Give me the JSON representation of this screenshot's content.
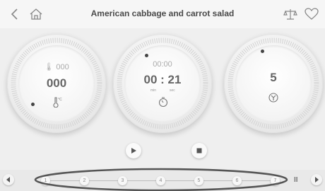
{
  "header": {
    "title": "American cabbage and carrot salad",
    "icons": [
      "back-chevron-icon",
      "home-icon",
      "scale-icon",
      "heart-icon"
    ]
  },
  "temperature_dial": {
    "top_value": "000",
    "main_value": "000",
    "icon": "thermometer-celsius-icon"
  },
  "timer_dial": {
    "top_value": "00:00",
    "main_value": "00 : 21",
    "unit_min": "min",
    "unit_sec": "sec",
    "icon": "timer-icon"
  },
  "speed_dial": {
    "main_value": "5",
    "icon": "fan-speed-icon"
  },
  "controls": {
    "play": "play-icon",
    "stop": "stop-icon"
  },
  "steps": {
    "labels": [
      "1",
      "2",
      "3",
      "4",
      "5",
      "6",
      "7"
    ],
    "pause": "II"
  },
  "colors": {
    "background": "#efefef",
    "accent_dark": "#444444",
    "annotation_ellipse": "#555555"
  }
}
